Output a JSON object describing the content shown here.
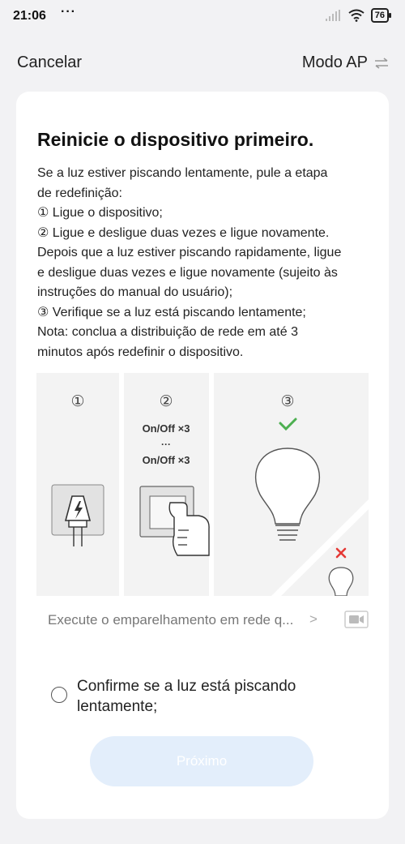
{
  "status": {
    "time": "21:06",
    "dots": "···",
    "battery": "76"
  },
  "nav": {
    "cancel": "Cancelar",
    "mode": "Modo AP"
  },
  "card": {
    "title": "Reinicie o dispositivo primeiro.",
    "lines": [
      "Se a luz estiver piscando lentamente, pule a etapa",
      "de redefinição:",
      "① Ligue o dispositivo;",
      "② Ligue e desligue duas vezes e ligue novamente.",
      "Depois que a luz estiver piscando rapidamente, ligue",
      "e desligue duas vezes e ligue novamente (sujeito às",
      "instruções do manual do usuário);",
      "③ Verifique se a luz está piscando lentamente;",
      "Nota: conclua a distribuição de rede em até 3",
      "minutos após redefinir o dispositivo."
    ]
  },
  "illustration": {
    "step1": "①",
    "step2": "②",
    "step3": "③",
    "onoff1": "On/Off ×3",
    "ellipsis": "···",
    "onoff2": "On/Off ×3",
    "check": "✓",
    "cross": "×"
  },
  "video": {
    "text": "Execute o emparelhamento em rede q...",
    "chevron": ">"
  },
  "confirm": {
    "text": "Confirme se a luz está piscando lentamente;"
  },
  "next_button": "Próximo",
  "colors": {
    "accent": "#4caf50",
    "error": "#e53935",
    "button": "#e3eefb"
  }
}
